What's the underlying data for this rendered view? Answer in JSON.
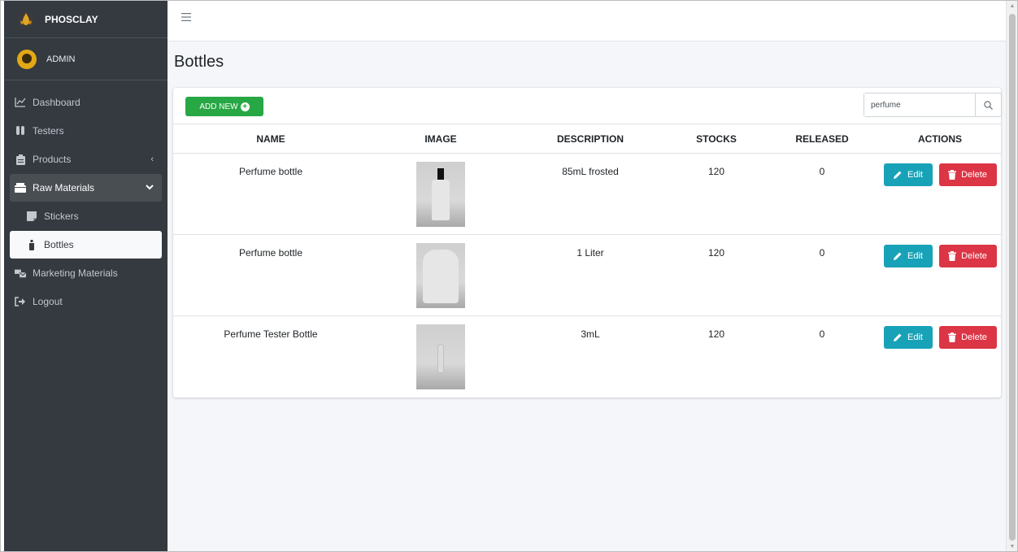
{
  "brand": {
    "name": "PHOSCLAY"
  },
  "user": {
    "name": "ADMIN"
  },
  "topbar": {
    "menu_icon": "hamburger-icon"
  },
  "sidebar": {
    "items": [
      {
        "label": "Dashboard",
        "icon": "chart-line-icon"
      },
      {
        "label": "Testers",
        "icon": "vials-icon"
      },
      {
        "label": "Products",
        "icon": "clipboard-icon",
        "caret": "‹"
      },
      {
        "label": "Raw Materials",
        "icon": "box-icon",
        "caret": "⌄"
      },
      {
        "label": "Stickers",
        "icon": "sticky-note-icon"
      },
      {
        "label": "Bottles",
        "icon": "bottle-icon"
      },
      {
        "label": "Marketing Materials",
        "icon": "mail-bulk-icon"
      },
      {
        "label": "Logout",
        "icon": "sign-out-icon"
      }
    ]
  },
  "page": {
    "title": "Bottles"
  },
  "toolbar": {
    "add_label": "ADD NEW"
  },
  "search": {
    "value": "perfume",
    "placeholder": ""
  },
  "table": {
    "headers": [
      "NAME",
      "IMAGE",
      "DESCRIPTION",
      "STOCKS",
      "RELEASED",
      "ACTIONS"
    ],
    "rows": [
      {
        "name": "Perfume bottle",
        "description": "85mL frosted",
        "stocks": "120",
        "released": "0"
      },
      {
        "name": "Perfume bottle",
        "description": "1 Liter",
        "stocks": "120",
        "released": "0"
      },
      {
        "name": "Perfume Tester Bottle",
        "description": "3mL",
        "stocks": "120",
        "released": "0"
      }
    ],
    "edit_label": "Edit",
    "delete_label": "Delete"
  },
  "colors": {
    "sidebar": "#343a40",
    "add_button": "#28a745",
    "edit_button": "#17a2b8",
    "delete_button": "#dc3545",
    "content_bg": "#f4f6f9"
  }
}
